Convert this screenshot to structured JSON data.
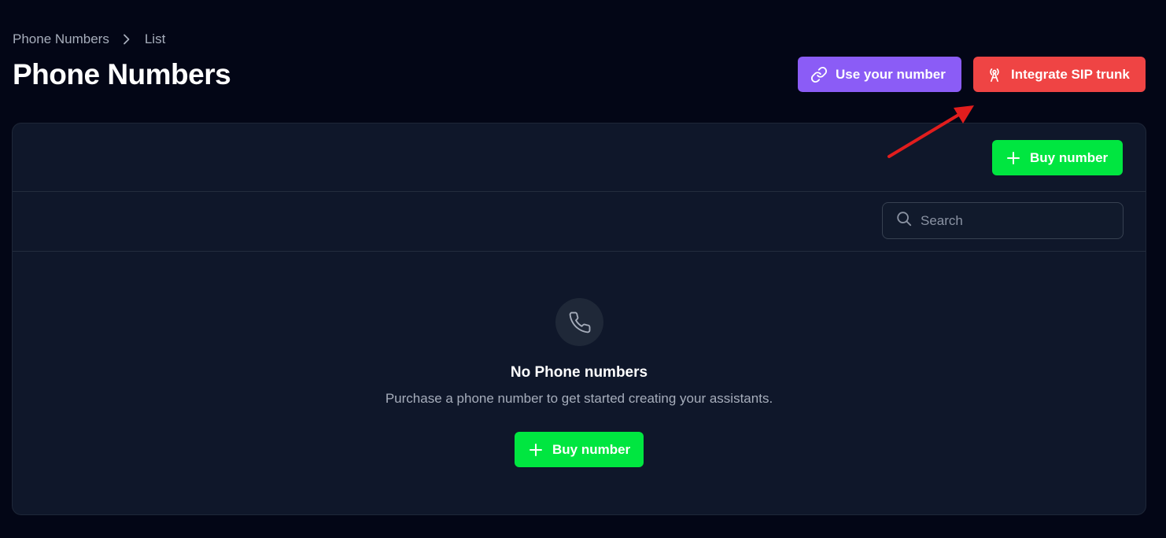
{
  "breadcrumb": {
    "items": [
      "Phone Numbers",
      "List"
    ]
  },
  "page": {
    "title": "Phone Numbers"
  },
  "header_actions": {
    "use_number_label": "Use your number",
    "use_number_icon": "link-icon",
    "sip_label": "Integrate SIP trunk",
    "sip_icon": "antenna-icon"
  },
  "toolbar": {
    "buy_label": "Buy number",
    "buy_icon": "plus-icon"
  },
  "search": {
    "placeholder": "Search",
    "value": ""
  },
  "empty_state": {
    "icon": "phone-icon",
    "title": "No Phone numbers",
    "description": "Purchase a phone number to get started creating your assistants.",
    "buy_label": "Buy number"
  },
  "colors": {
    "background": "#030616",
    "panel": "#0f172a",
    "use_number_button": "#8b5cf6",
    "sip_button": "#ef4444",
    "buy_button": "#00e640",
    "annotation_arrow": "#e11d1d"
  }
}
